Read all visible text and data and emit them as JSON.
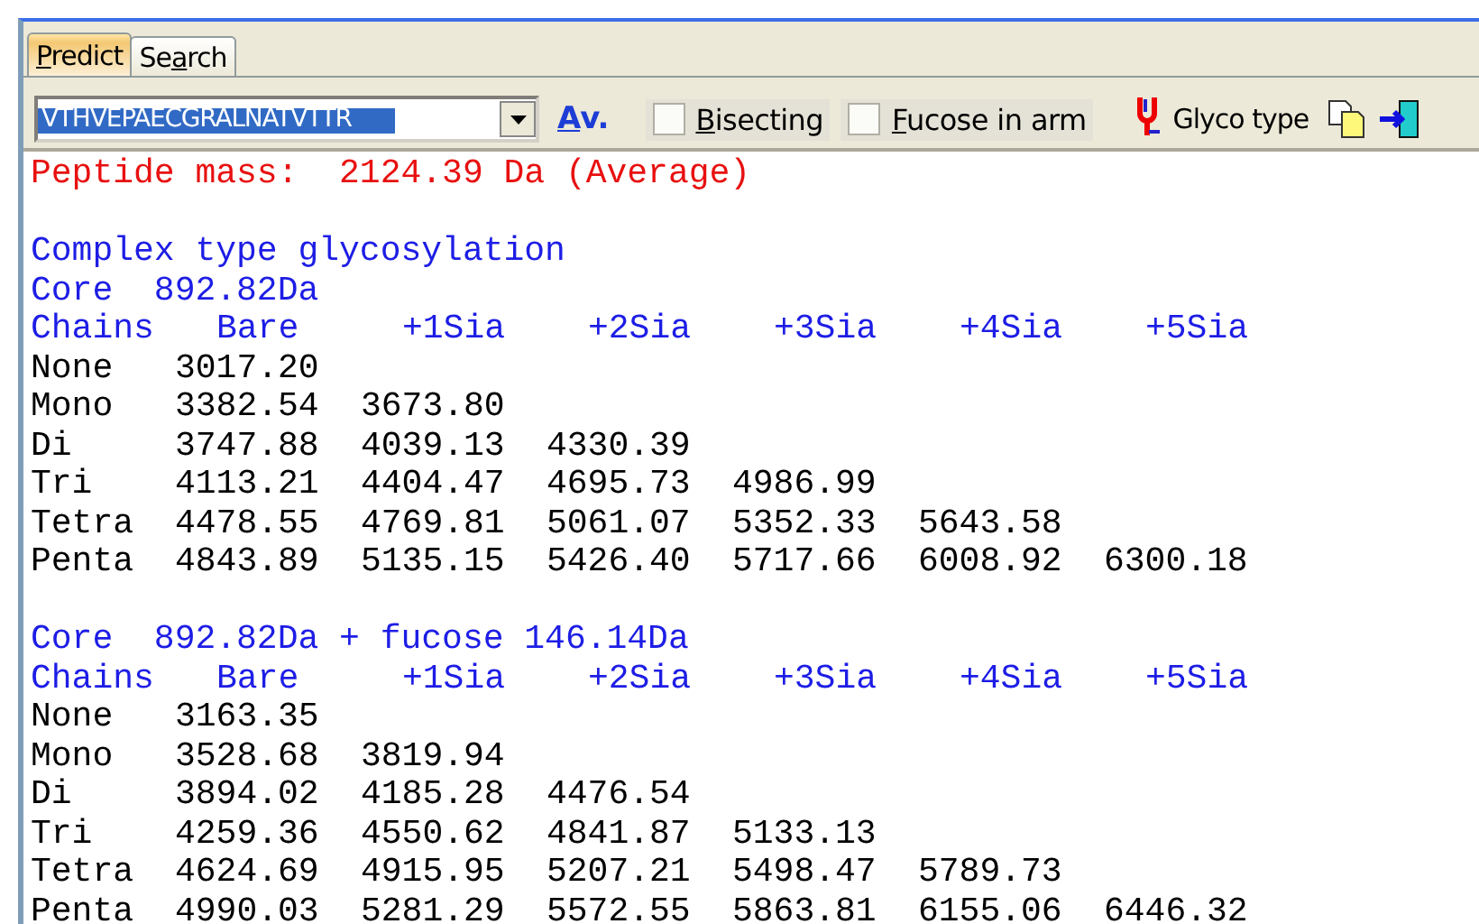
{
  "tabs": [
    {
      "access_key": "P",
      "label_after": "redict",
      "selected": true
    },
    {
      "label_before": "Se",
      "access_key": "a",
      "label_after": "rch",
      "selected": false
    }
  ],
  "toolbar": {
    "sequence": "VTHVEPAECGRALNATVTTR",
    "mass_mode": {
      "access_key": "A",
      "label_after": "v."
    },
    "options": [
      {
        "access_key": "B",
        "label_after": "isecting",
        "checked": false
      },
      {
        "access_key": "F",
        "label_after": "ucose in arm",
        "checked": false
      }
    ],
    "glyco_type": "Glyco type"
  },
  "output": {
    "peptide_mass": "Peptide mass:  2124.39 Da (Average)",
    "heading": "Complex type glycosylation",
    "sections": [
      {
        "core": "Core  892.82Da",
        "columns": [
          "Chains",
          "Bare",
          "+1Sia",
          "+2Sia",
          "+3Sia",
          "+4Sia",
          "+5Sia"
        ],
        "rows": [
          {
            "chains": "None",
            "values": [
              "3017.20"
            ]
          },
          {
            "chains": "Mono",
            "values": [
              "3382.54",
              "3673.80"
            ]
          },
          {
            "chains": "Di",
            "values": [
              "3747.88",
              "4039.13",
              "4330.39"
            ]
          },
          {
            "chains": "Tri",
            "values": [
              "4113.21",
              "4404.47",
              "4695.73",
              "4986.99"
            ]
          },
          {
            "chains": "Tetra",
            "values": [
              "4478.55",
              "4769.81",
              "5061.07",
              "5352.33",
              "5643.58"
            ]
          },
          {
            "chains": "Penta",
            "values": [
              "4843.89",
              "5135.15",
              "5426.40",
              "5717.66",
              "6008.92",
              "6300.18"
            ]
          }
        ]
      },
      {
        "core": "Core  892.82Da + fucose 146.14Da",
        "columns": [
          "Chains",
          "Bare",
          "+1Sia",
          "+2Sia",
          "+3Sia",
          "+4Sia",
          "+5Sia"
        ],
        "rows": [
          {
            "chains": "None",
            "values": [
              "3163.35"
            ]
          },
          {
            "chains": "Mono",
            "values": [
              "3528.68",
              "3819.94"
            ]
          },
          {
            "chains": "Di",
            "values": [
              "3894.02",
              "4185.28",
              "4476.54"
            ]
          },
          {
            "chains": "Tri",
            "values": [
              "4259.36",
              "4550.62",
              "4841.87",
              "5133.13"
            ]
          },
          {
            "chains": "Tetra",
            "values": [
              "4624.69",
              "4915.95",
              "5207.21",
              "5498.47",
              "5789.73"
            ]
          },
          {
            "chains": "Penta",
            "values": [
              "4990.03",
              "5281.29",
              "5572.55",
              "5863.81",
              "6155.06",
              "6446.32"
            ]
          }
        ]
      }
    ]
  }
}
